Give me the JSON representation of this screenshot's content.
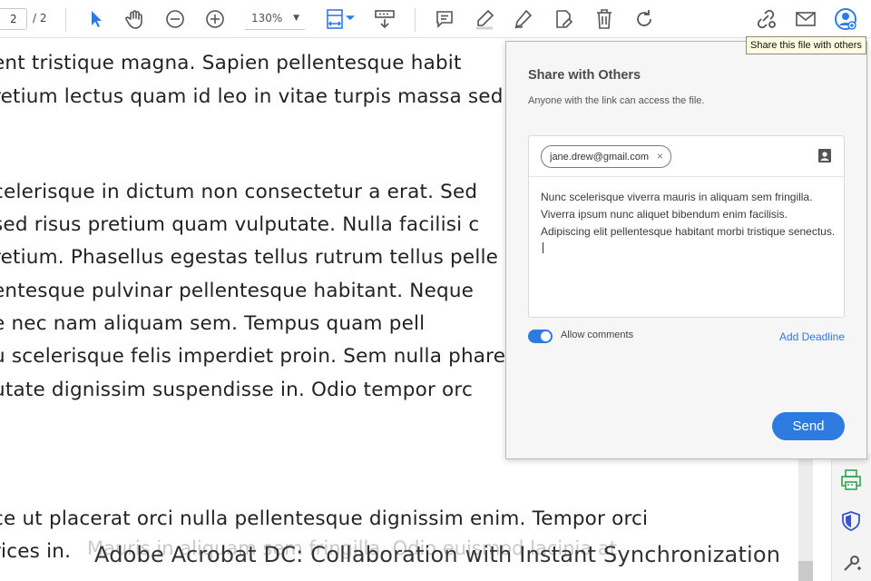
{
  "toolbar": {
    "page_current": "2",
    "page_total": "/ 2",
    "zoom": "130%",
    "icons": [
      "select-arrow-icon",
      "hand-icon",
      "zoom-out-icon",
      "zoom-in-icon",
      "fit-page-icon",
      "scroll-mode-icon",
      "comment-icon",
      "highlight-icon",
      "draw-icon",
      "edit-icon",
      "trash-icon",
      "rotate-icon",
      "link-icon",
      "email-icon",
      "share-user-icon"
    ],
    "accent": "#2d7be0"
  },
  "tooltip": "Share this file with others",
  "document": {
    "lines": [
      "ent tristique magna. Sapien pellentesque habit",
      "retium lectus quam id leo in vitae turpis massa sed",
      "celerisque in dictum non consectetur a erat. Sed",
      " sed risus pretium quam vulputate. Nulla facilisi c",
      "retium. Phasellus egestas tellus rutrum tellus pelle",
      "entesque pulvinar pellentesque habitant. Neque",
      "e nec nam aliquam sem. Tempus quam pell",
      "u scelerisque felis imperdiet proin. Sem nulla phare",
      "utate dignissim suspendisse in. Odio tempor orc",
      ".",
      "ce ut placerat orci nulla pellentesque dignissim enim. Tempor orci",
      "rices in."
    ],
    "ghost_line": "Mauris in aliquam sem fringilla. Odio euismod lacinia at"
  },
  "share_panel": {
    "title": "Share with Others",
    "subtitle": "Anyone with the link can access the file.",
    "recipient": "jane.drew@gmail.com",
    "remove_symbol": "×",
    "message": "Nunc scelerisque viverra mauris in aliquam sem fringilla. Viverra ipsum nunc aliquet bibendum enim facilisis. Adipiscing elit pellentesque habitant morbi tristique senectus.",
    "allow_comments_label": "Allow comments",
    "allow_comments_on": true,
    "add_deadline": "Add Deadline",
    "send": "Send"
  },
  "caption": "Adobe Acrobat DC: Collaboration with Instant Synchronization"
}
